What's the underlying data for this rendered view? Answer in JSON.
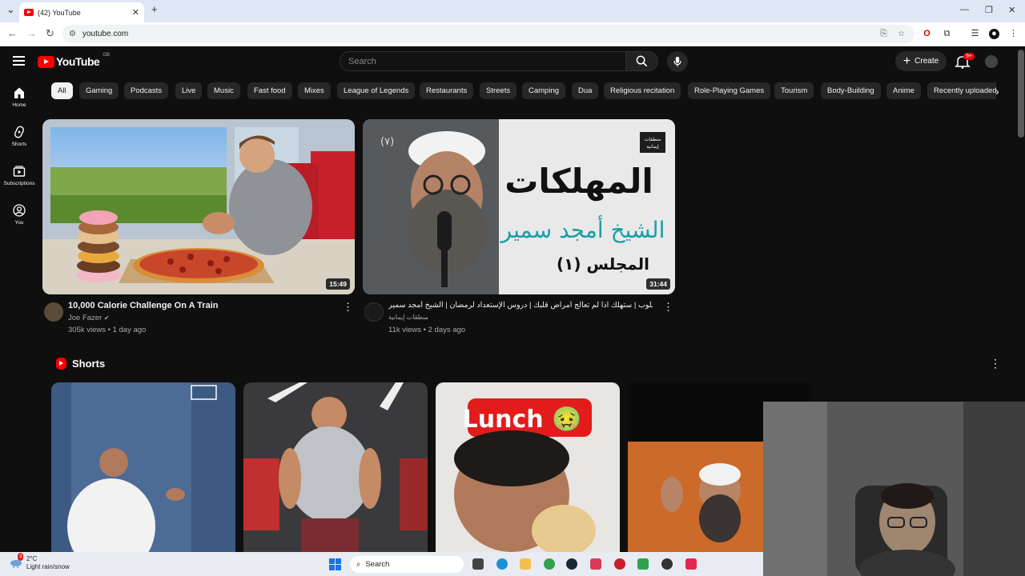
{
  "browser": {
    "tab_title": "(42) YouTube",
    "url": "youtube.com"
  },
  "header": {
    "logo_text": "YouTube",
    "country_code": "GB",
    "search_placeholder": "Search",
    "create_label": "Create",
    "notifications_badge": "9+"
  },
  "sidebar": {
    "items": [
      {
        "label": "Home",
        "icon": "home-icon"
      },
      {
        "label": "Shorts",
        "icon": "shorts-icon"
      },
      {
        "label": "Subscriptions",
        "icon": "subscriptions-icon"
      },
      {
        "label": "You",
        "icon": "you-icon"
      }
    ]
  },
  "chips": [
    "All",
    "Gaming",
    "Podcasts",
    "Live",
    "Music",
    "Fast food",
    "Mixes",
    "League of Legends",
    "Restaurants",
    "Streets",
    "Camping",
    "Dua",
    "Religious recitation",
    "Role-Playing Games",
    "Tourism",
    "Body-Building",
    "Anime",
    "Recently uploaded"
  ],
  "videos": [
    {
      "title": "10,000 Calorie Challenge On A Train",
      "channel": "Joe Fazer",
      "stats": "305k views • 1 day ago",
      "duration": "15:49"
    },
    {
      "title": "مهلكات القلوب | ستهلك اذا لم تعالج أمراض قلبك | دروس الإستعداد لرمضان | الشيخ أمجد سمير",
      "channel": "منطقات إيمانية",
      "stats": "11k views • 2 days ago",
      "duration": "31:44",
      "thumb_title": "المهلكات",
      "thumb_subtitle": "الشيخ أمجد سمير",
      "thumb_session": "المجلس (١)",
      "thumb_number": "(٧)"
    }
  ],
  "shorts": {
    "heading": "Shorts",
    "items": [
      {
        "overlay": ""
      },
      {
        "overlay": ""
      },
      {
        "overlay": "Lunch 🤢"
      },
      {
        "overlay": ""
      }
    ]
  },
  "taskbar": {
    "weather_temp": "2°C",
    "weather_desc": "Light rain/snow",
    "weather_alert": "3",
    "search_label": "Search"
  },
  "colors": {
    "yt_red": "#ff0000",
    "background": "#0f0f0f",
    "chip_bg": "#272727"
  }
}
